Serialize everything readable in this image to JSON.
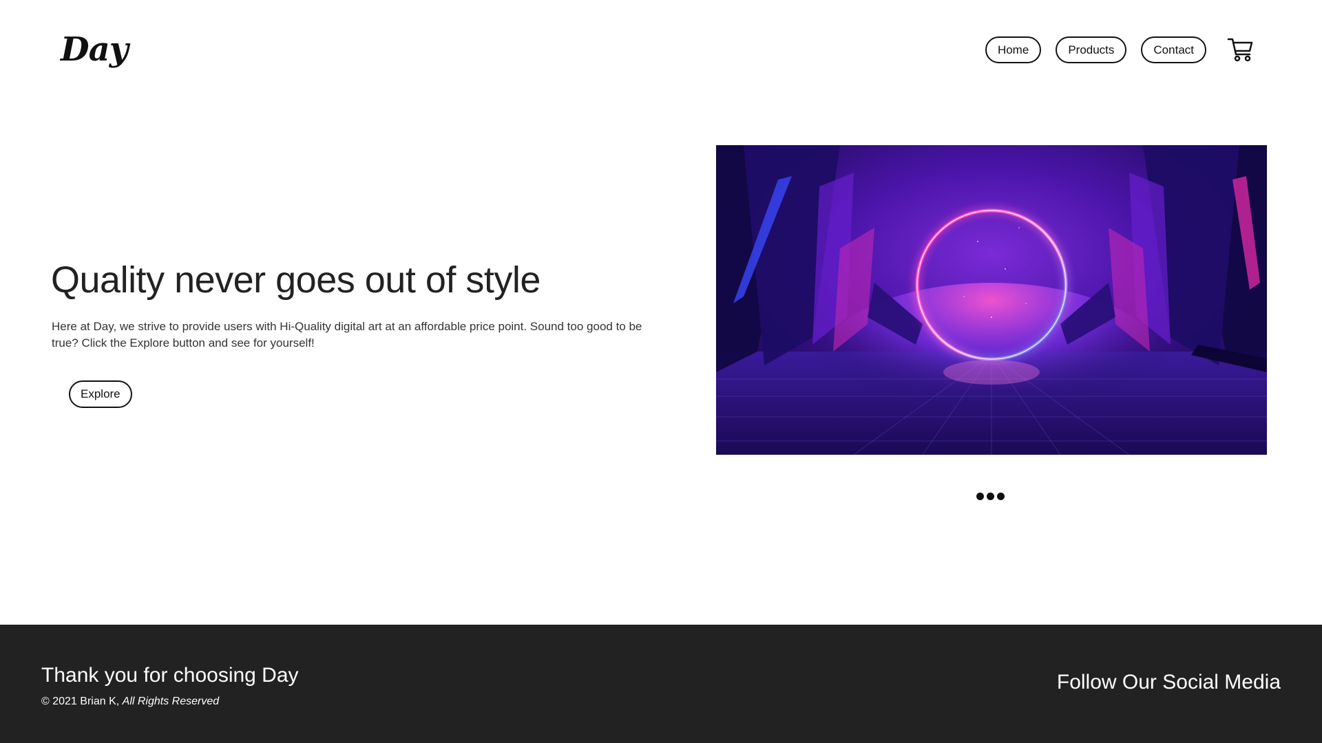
{
  "header": {
    "logo": "Day",
    "nav": [
      {
        "label": "Home"
      },
      {
        "label": "Products"
      },
      {
        "label": "Contact"
      }
    ],
    "cart_icon": "shopping-cart-icon"
  },
  "hero": {
    "title": "Quality never goes out of style",
    "description": "Here at Day, we strive to provide users with Hi-Quality digital art at an affordable price point. Sound too good to be true? Click the Explore button and see for yourself!",
    "explore_label": "Explore",
    "image_alt": "neon-ring-artwork",
    "carousel_dots": 3
  },
  "footer": {
    "thanks": "Thank you for choosing Day",
    "copyright": "© 2021 Brian K,",
    "rights": "All Rights Reserved",
    "follow": "Follow Our Social Media"
  },
  "colors": {
    "footer_bg": "#232223",
    "text_dark": "#222222",
    "neon_pink": "#ff2fb4",
    "neon_blue": "#3a5bff",
    "deep_purple": "#2a0a6e"
  }
}
